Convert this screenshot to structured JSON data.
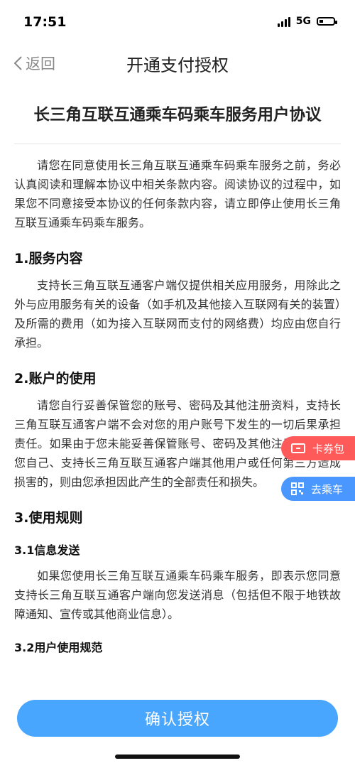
{
  "status": {
    "time": "17:51",
    "network": "5G"
  },
  "nav": {
    "back_label": "返回",
    "title": "开通支付授权"
  },
  "document": {
    "title": "长三角互联互通乘车码乘车服务用户协议",
    "intro": "请您在同意使用长三角互联互通乘车码乘车服务之前，务必认真阅读和理解本协议中相关条款内容。阅读协议的过程中，如果您不同意接受本协议的任何条款内容，请立即停止使用长三角互联互通乘车码乘车服务。",
    "s1_heading": "1.服务内容",
    "s1_body": "支持长三角互联互通客户端仅提供相关应用服务，用除此之外与应用服务有关的设备（如手机及其他接入互联网有关的装置）及所需的费用（如为接入互联网而支付的网络费）均应由您自行承担。",
    "s2_heading": "2.账户的使用",
    "s2_body": "请您自行妥善保管您的账号、密码及其他注册资料，支持长三角互联互通客户端不会对您的用户账号下发生的一切后果承担责任。如果由于您未能妥善保管账号、密码及其他注册资料而使您自己、支持长三角互联互通客户端其他用户或任何第三方造成损害的，则由您承担因此产生的全部责任和损失。",
    "s3_heading": "3.使用规则",
    "s31_heading": "3.1信息发送",
    "s31_body": "如果您使用长三角互联互通乘车码乘车服务，即表示您同意支持长三角互联互通客户端向您发送消息（包括但不限于地铁故障通知、宣传或其他商业信息）。",
    "s32_heading": "3.2用户使用规范"
  },
  "floating": {
    "coupon_label": "卡券包",
    "ride_label": "去乘车"
  },
  "footer": {
    "confirm_label": "确认授权"
  },
  "colors": {
    "primary": "#48a6ff",
    "coupon": "#ff5a5a",
    "ride": "#4a98ff"
  }
}
